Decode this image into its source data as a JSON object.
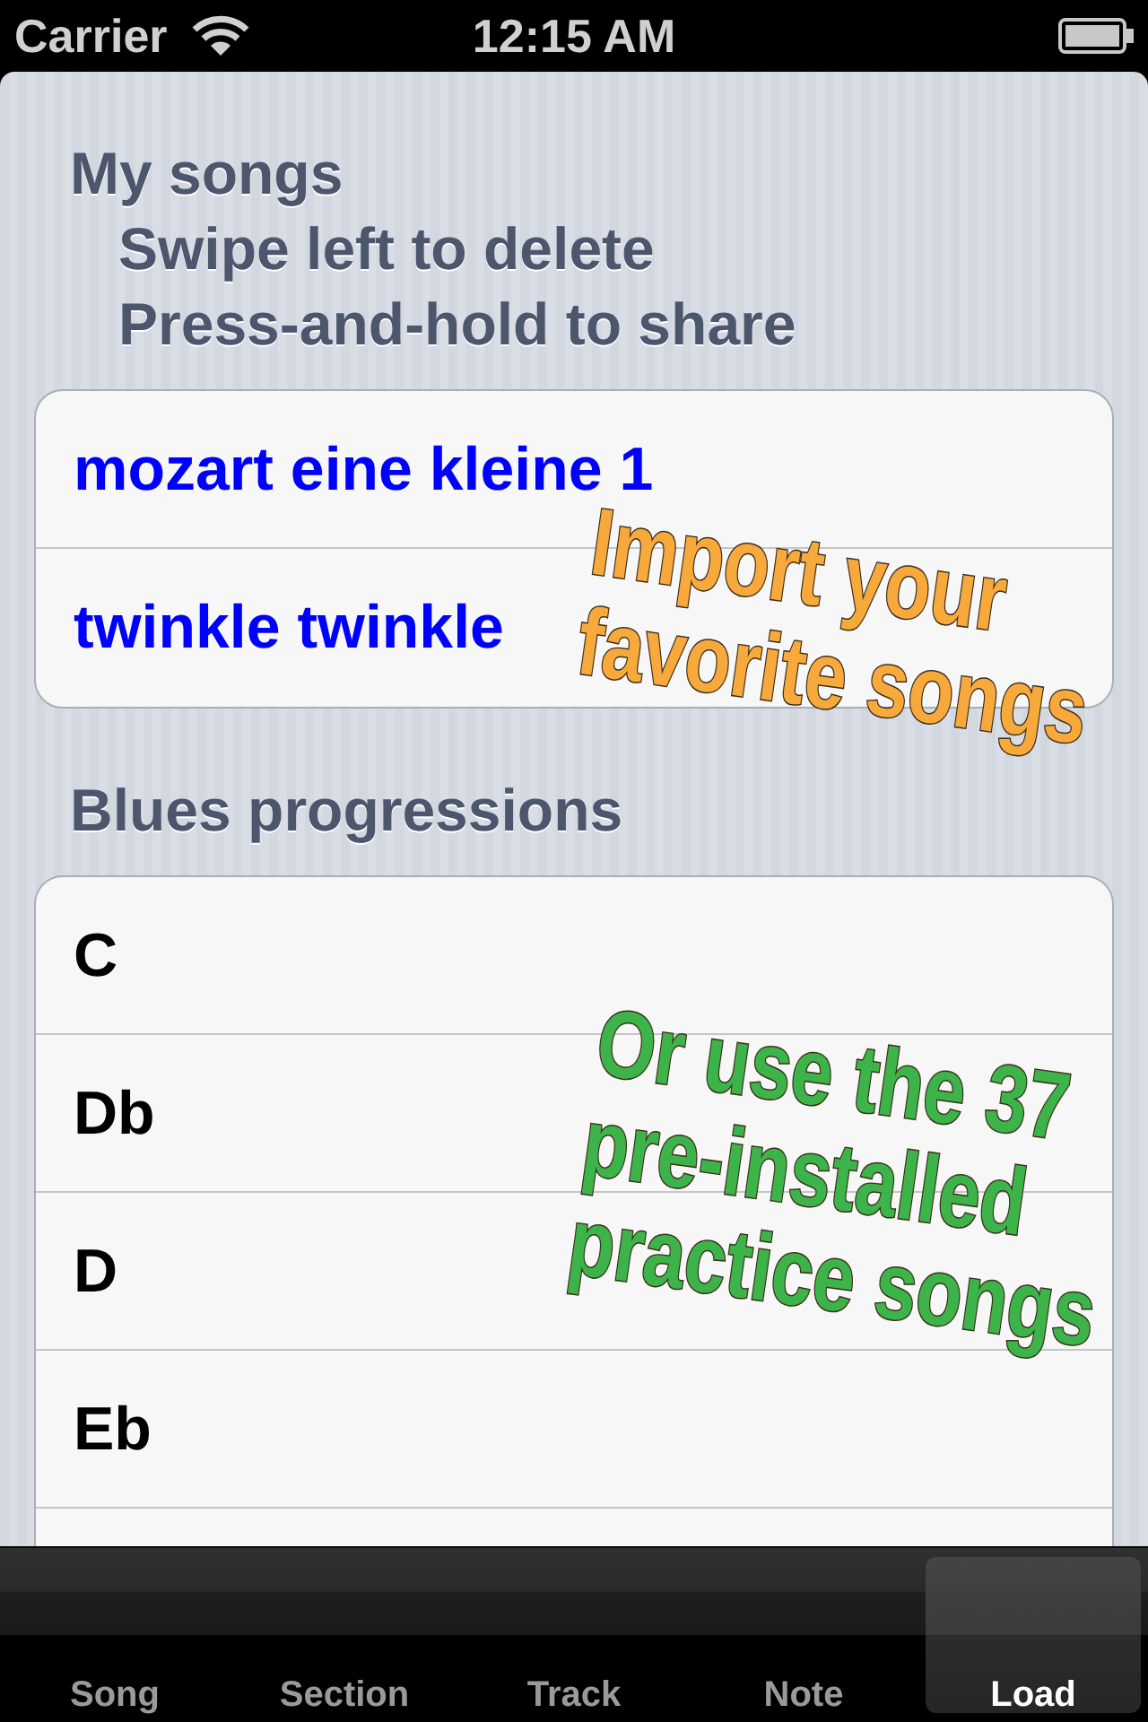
{
  "status_bar": {
    "carrier": "Carrier",
    "time": "12:15 AM"
  },
  "sections": [
    {
      "title": "My songs",
      "hints": [
        "Swipe left to delete",
        "Press-and-hold to share"
      ],
      "more_below": false,
      "rows": [
        {
          "label": "mozart eine kleine 1",
          "kind": "user"
        },
        {
          "label": "twinkle twinkle",
          "kind": "user"
        }
      ]
    },
    {
      "title": "Blues progressions",
      "more_below": true,
      "rows": [
        {
          "label": "C",
          "kind": "preset"
        },
        {
          "label": "Db",
          "kind": "preset"
        },
        {
          "label": "D",
          "kind": "preset"
        },
        {
          "label": "Eb",
          "kind": "preset"
        }
      ]
    }
  ],
  "callouts": [
    {
      "lines": [
        "Import your",
        "favorite songs"
      ],
      "color": "#f7a93c"
    },
    {
      "lines": [
        "Or use the 37",
        "pre-installed",
        "practice songs"
      ],
      "color": "#3cb44a"
    }
  ],
  "tab_bar": [
    {
      "label": "Song",
      "selected": false
    },
    {
      "label": "Section",
      "selected": false
    },
    {
      "label": "Track",
      "selected": false
    },
    {
      "label": "Note",
      "selected": false
    },
    {
      "label": "Load",
      "selected": true
    }
  ]
}
